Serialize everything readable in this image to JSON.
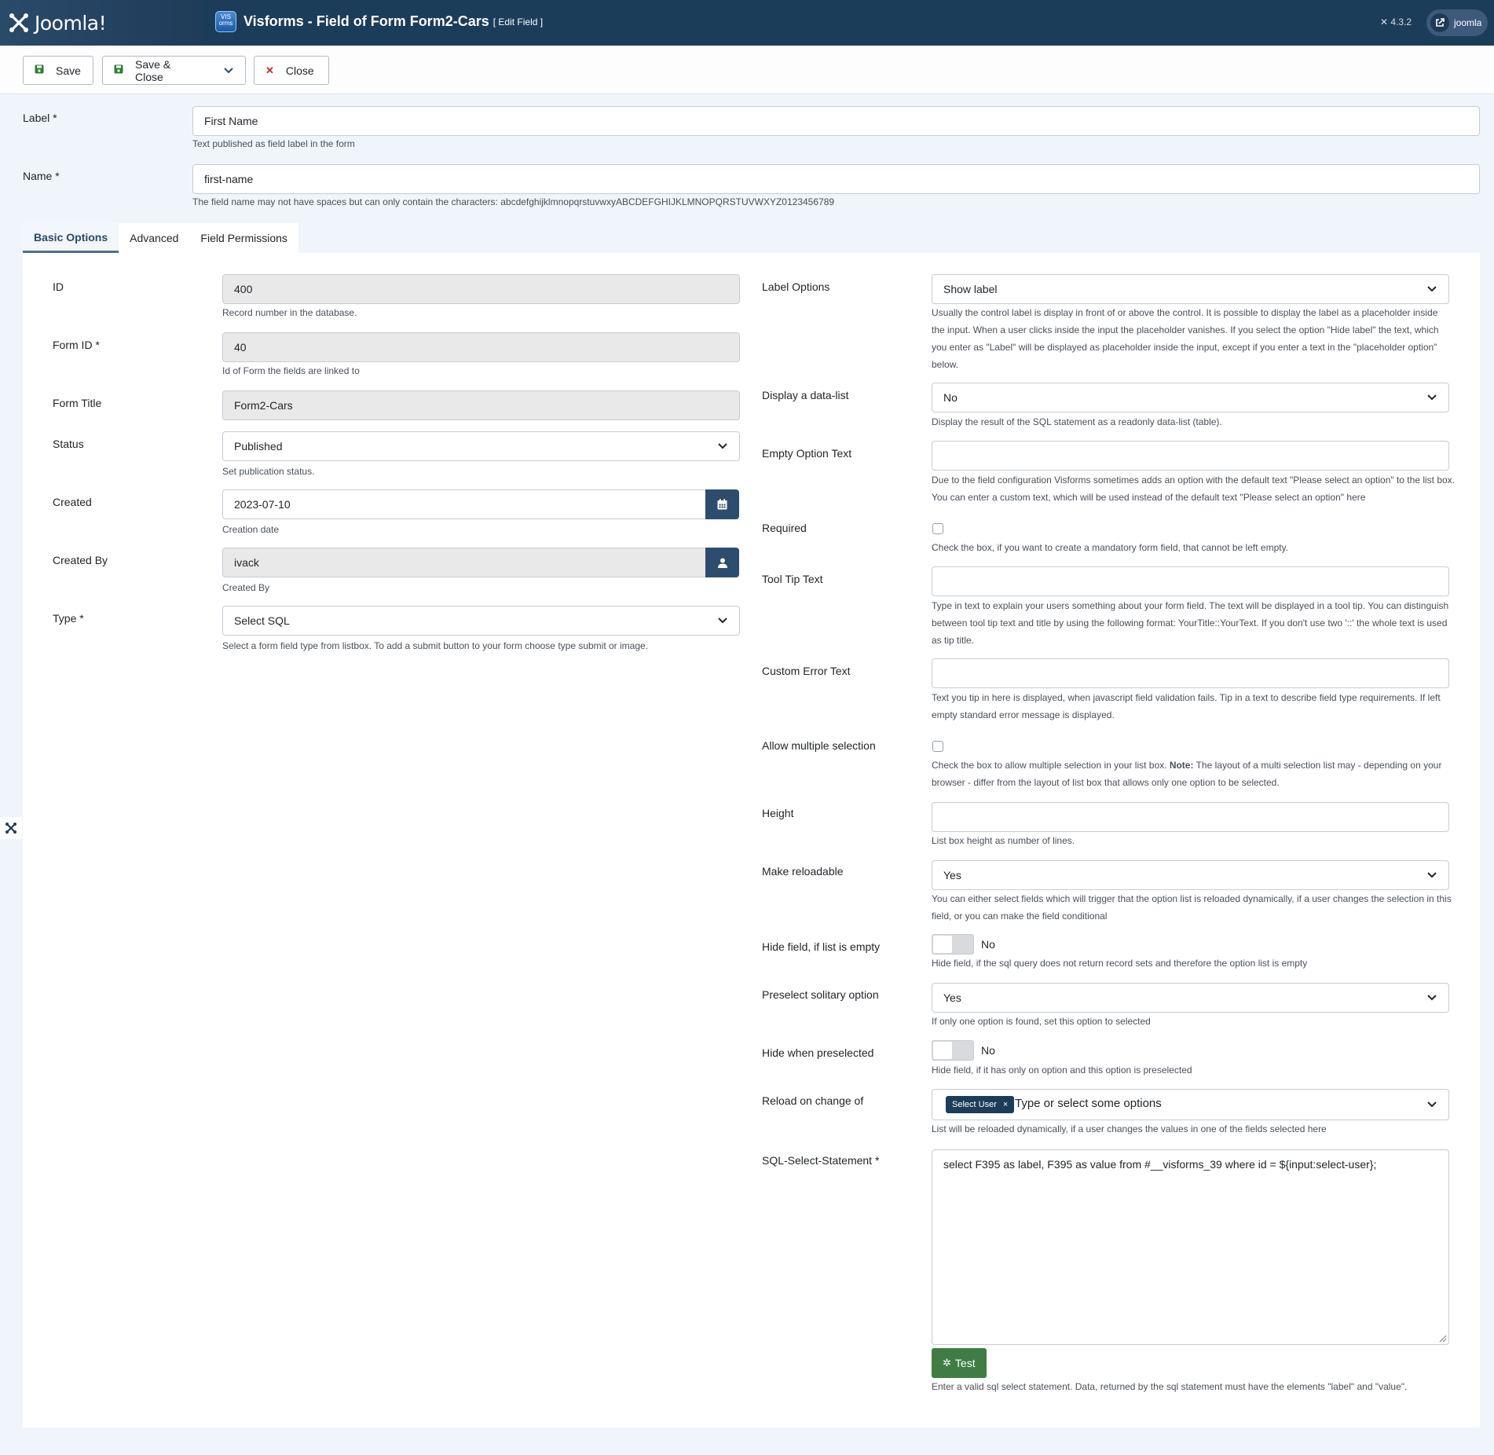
{
  "header": {
    "logo_text": "Joomla!",
    "app_icon_text": "VIS orms",
    "title": "Visforms - Field of Form Form2-Cars",
    "subtitle": "[ Edit Field ]",
    "version": "4.3.2",
    "user_label": "joomla"
  },
  "toolbar": {
    "save_label": "Save",
    "save_close_label": "Save & Close",
    "close_label": "Close"
  },
  "top_fields": {
    "label": {
      "label": "Label *",
      "value": "First Name",
      "help": "Text published as field label in the form"
    },
    "name": {
      "label": "Name *",
      "value": "first-name",
      "help": "The field name may not have spaces but can only contain the characters: abcdefghijklmnopqrstuvwxyABCDEFGHIJKLMNOPQRSTUVWXYZ0123456789"
    }
  },
  "tabs": [
    {
      "label": "Basic Options",
      "active": true
    },
    {
      "label": "Advanced",
      "active": false
    },
    {
      "label": "Field Permissions",
      "active": false
    }
  ],
  "left": {
    "id": {
      "label": "ID",
      "value": "400",
      "help": "Record number in the database."
    },
    "form_id": {
      "label": "Form ID *",
      "value": "40",
      "help": "Id of Form the fields are linked to"
    },
    "form_title": {
      "label": "Form Title",
      "value": "Form2-Cars"
    },
    "status": {
      "label": "Status",
      "value": "Published",
      "help": "Set publication status."
    },
    "created": {
      "label": "Created",
      "value": "2023-07-10",
      "help": "Creation date"
    },
    "created_by": {
      "label": "Created By",
      "value": "ivack",
      "help": "Created By"
    },
    "type": {
      "label": "Type *",
      "value": "Select SQL",
      "help": "Select a form field type from listbox. To add a submit button to your form choose type submit or image."
    }
  },
  "right": {
    "label_options": {
      "label": "Label Options",
      "value": "Show label",
      "help": "Usually the control label is display in front of or above the control. It is possible to display the label as a placeholder inside the input. When a user clicks inside the input the placeholder vanishes. If you select the option \"Hide label\" the text, which you enter as \"Label\" will be displayed as placeholder inside the input, except if you enter a text in the \"placeholder option\" below."
    },
    "data_list": {
      "label": "Display a data-list",
      "value": "No",
      "help": "Display the result of the SQL statement as a readonly data-list (table)."
    },
    "empty_option": {
      "label": "Empty Option Text",
      "value": "",
      "help": "Due to the field configuration Visforms sometimes adds an option with the default text \"Please select an option\" to the list box. You can enter a custom text, which will be used instead of the default text \"Please select an option\" here"
    },
    "required": {
      "label": "Required",
      "help": "Check the box, if you want to create a mandatory form field, that cannot be left empty."
    },
    "tooltip": {
      "label": "Tool Tip Text",
      "value": "",
      "help": "Type in text to explain your users something about your form field. The text will be displayed in a tool tip. You can distinguish between tool tip text and title by using the following format: YourTitle::YourText. If you don't use two '::' the whole text is used as tip title."
    },
    "custom_error": {
      "label": "Custom Error Text",
      "value": "",
      "help": "Text you tip in here is displayed, when javascript field validation fails. Tip in a text to describe field type requirements. If left empty standard error message is displayed."
    },
    "multiple": {
      "label": "Allow multiple selection",
      "help_pre": "Check the box to allow multiple selection in your list box. ",
      "help_bold": "Note:",
      "help_post": " The layout of a multi selection list may - depending on your browser - differ from the layout of list box that allows only one option to be selected."
    },
    "height": {
      "label": "Height",
      "value": "",
      "help": "List box height as number of lines."
    },
    "reloadable": {
      "label": "Make reloadable",
      "value": "Yes",
      "help": "You can either select fields which will trigger that the option list is reloaded dynamically, if a user changes the selection in this field, or you can make the field conditional"
    },
    "hide_empty": {
      "label": "Hide field, if list is empty",
      "value": "No",
      "help": "Hide field, if the sql query does not return record sets and therefore the option list is empty"
    },
    "preselect": {
      "label": "Preselect solitary option",
      "value": "Yes",
      "help": "If only one option is found, set this option to selected"
    },
    "hide_preselected": {
      "label": "Hide when preselected",
      "value": "No",
      "help": "Hide field, if it has only on option and this option is preselected"
    },
    "reload_on": {
      "label": "Reload on change of",
      "chip": "Select User",
      "chip_close": "×",
      "placeholder": "Type or select some options",
      "help": "List will be reloaded dynamically, if a user changes the values in one of the fields selected here"
    },
    "sql": {
      "label": "SQL-Select-Statement *",
      "value": "select F395 as label, F395 as value  from #__visforms_39 where id = ${input:select-user};",
      "button": "Test",
      "help": "Enter a valid sql select statement. Data, returned by the sql statement must have the elements \"label\" and \"value\"."
    }
  },
  "colors": {
    "header_bg": "#1c3d5a",
    "accent": "#2c4d6e",
    "test_button": "#3f7d45"
  }
}
